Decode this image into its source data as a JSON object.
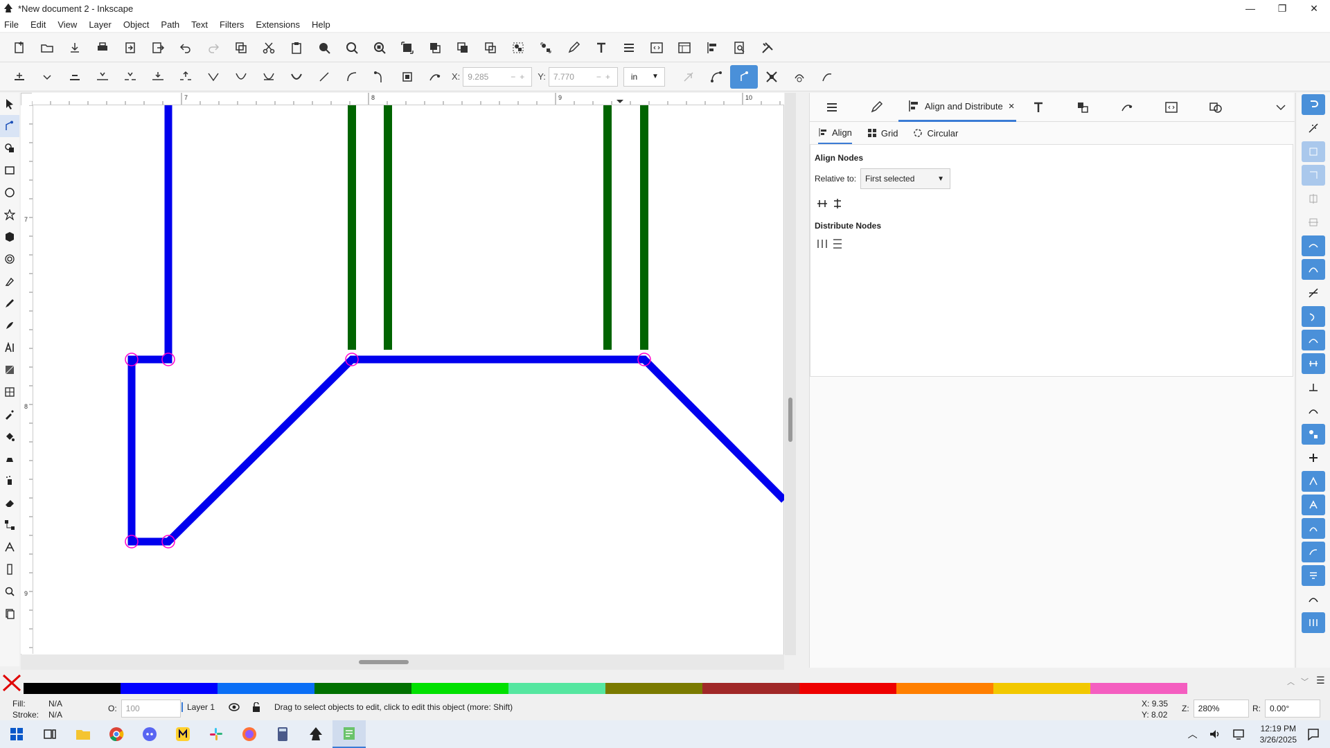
{
  "window": {
    "title": "*New document 2 - Inkscape",
    "minimize_glyph": "—",
    "restore_glyph": "❐",
    "close_glyph": "✕"
  },
  "menu": [
    "File",
    "Edit",
    "View",
    "Layer",
    "Object",
    "Path",
    "Text",
    "Filters",
    "Extensions",
    "Help"
  ],
  "node_toolbar": {
    "x_label": "X:",
    "x_value": "9.285",
    "y_label": "Y:",
    "y_value": "7.770",
    "unit": "in",
    "spin_controls": "−+"
  },
  "rulers": {
    "h_ticks": [
      "7",
      "8",
      "9",
      "10"
    ],
    "v_ticks": [
      "7",
      "8",
      "9"
    ]
  },
  "dock": {
    "active_tab_label": "Align and Distribute",
    "close_glyph": "×",
    "subtabs": [
      "Align",
      "Grid",
      "Circular"
    ],
    "align_nodes_heading": "Align Nodes",
    "relative_to_label": "Relative to:",
    "relative_to_value": "First selected",
    "distribute_nodes_heading": "Distribute Nodes"
  },
  "palette": {
    "colors": [
      "#000000",
      "#0000ff",
      "#0a6ef5",
      "#007000",
      "#00e000",
      "#55e6a0",
      "#7a7a00",
      "#a02828",
      "#ee0000",
      "#ff7f00",
      "#f2c800",
      "#f45ec0"
    ]
  },
  "status": {
    "fill_label": "Fill:",
    "fill_value": "N/A",
    "stroke_label": "Stroke:",
    "stroke_value": "N/A",
    "opacity_label": "O:",
    "opacity_value": "100",
    "layer_name": "Layer 1",
    "message": "Drag to select objects to edit, click to edit this object (more: Shift)",
    "cursor_x_label": "X:",
    "cursor_x": "9.35",
    "cursor_y_label": "Y:",
    "cursor_y": "8.02",
    "zoom_label": "Z:",
    "zoom": "280%",
    "rotation_label": "R:",
    "rotation": "0.00°"
  },
  "taskbar": {
    "time": "12:19 PM",
    "date": "3/26/2025"
  },
  "colors": {
    "blue_path": "#0000ee",
    "green_path": "#006400",
    "node_handle": "#ff00cc",
    "accent": "#3a7bd5"
  }
}
